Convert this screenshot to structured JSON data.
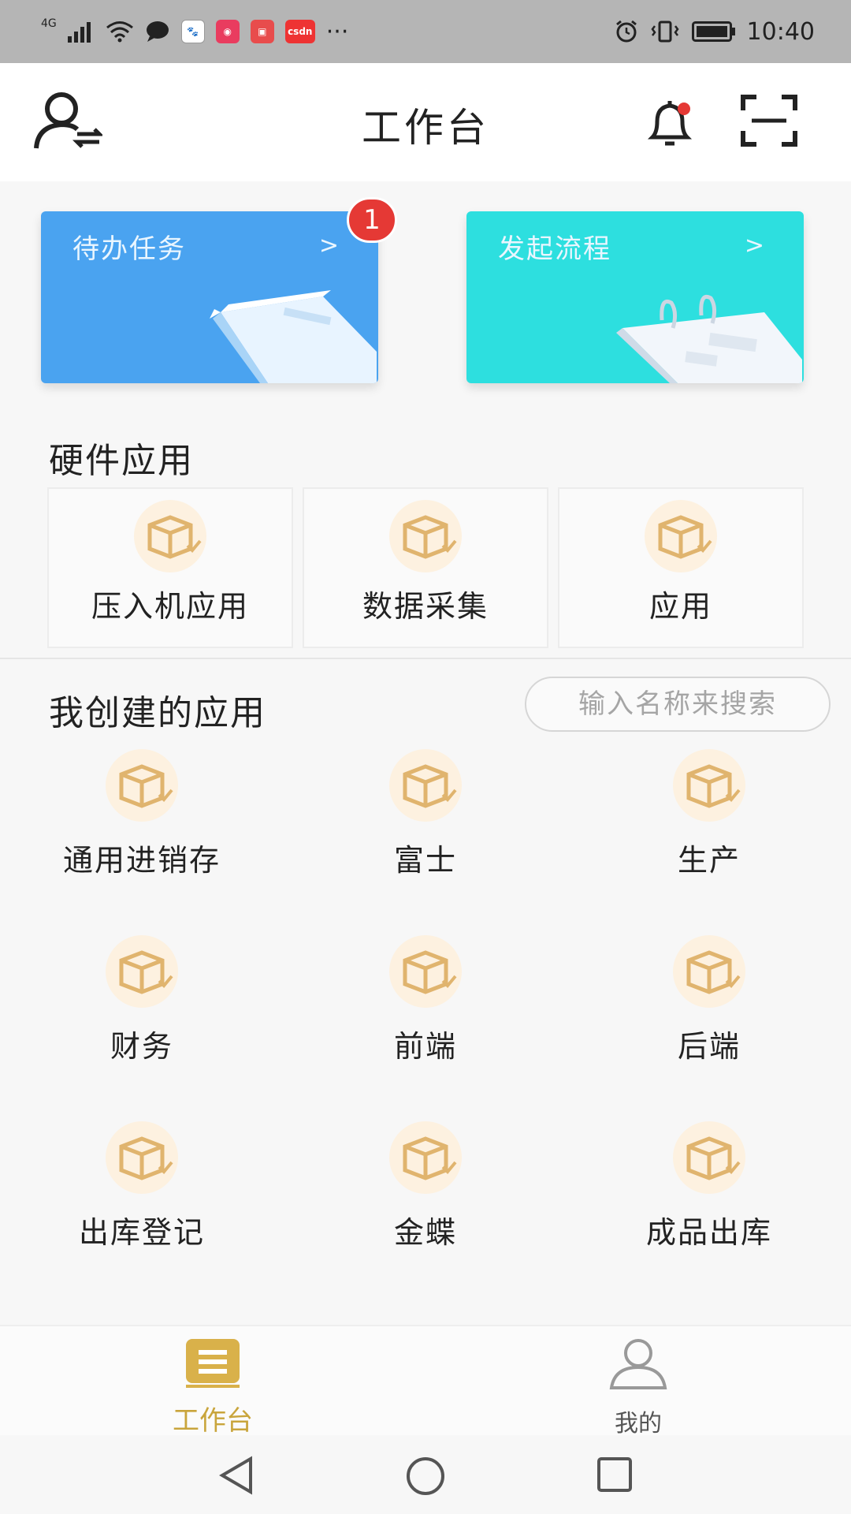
{
  "status_bar": {
    "network": "4G",
    "apps": [
      {
        "icon": "chat-bubble-icon"
      },
      {
        "icon": "baidu-paw-icon"
      },
      {
        "icon": "weibo-icon"
      },
      {
        "icon": "shop-bag-icon"
      },
      {
        "icon": "csdn-icon",
        "text": "csdn"
      }
    ],
    "more": "···",
    "time": "10:40"
  },
  "header": {
    "title": "工作台",
    "left_icon": "user-switch-icon",
    "bell_icon": "bell-icon",
    "scan_icon": "scan-icon"
  },
  "cards": {
    "todo": {
      "label": "待办任务",
      "arrow": ">",
      "badge": "1",
      "color": "#4aa3f0"
    },
    "flow": {
      "label": "发起流程",
      "arrow": ">",
      "color": "#2ddfdf"
    }
  },
  "hardware": {
    "title": "硬件应用",
    "items": [
      {
        "label": "压入机应用",
        "icon": "box-icon"
      },
      {
        "label": "数据采集",
        "icon": "box-icon"
      },
      {
        "label": "应用",
        "icon": "box-icon"
      }
    ]
  },
  "my_apps": {
    "title": "我创建的应用",
    "search_placeholder": "输入名称来搜索",
    "items": [
      {
        "label": "通用进销存",
        "icon": "box-icon"
      },
      {
        "label": "富士",
        "icon": "box-icon"
      },
      {
        "label": "生产",
        "icon": "box-icon"
      },
      {
        "label": "财务",
        "icon": "box-icon"
      },
      {
        "label": "前端",
        "icon": "box-icon"
      },
      {
        "label": "后端",
        "icon": "box-icon"
      },
      {
        "label": "出库登记",
        "icon": "box-icon"
      },
      {
        "label": "金蝶",
        "icon": "box-icon"
      },
      {
        "label": "成品出库",
        "icon": "box-icon"
      }
    ]
  },
  "bottom_nav": {
    "items": [
      {
        "label": "工作台",
        "icon": "workbench-icon",
        "active": true
      },
      {
        "label": "我的",
        "icon": "profile-icon",
        "active": false
      }
    ],
    "active_color": "#c9a53c"
  },
  "system_nav": {
    "back": "back-icon",
    "home": "home-icon",
    "recents": "recents-icon"
  }
}
